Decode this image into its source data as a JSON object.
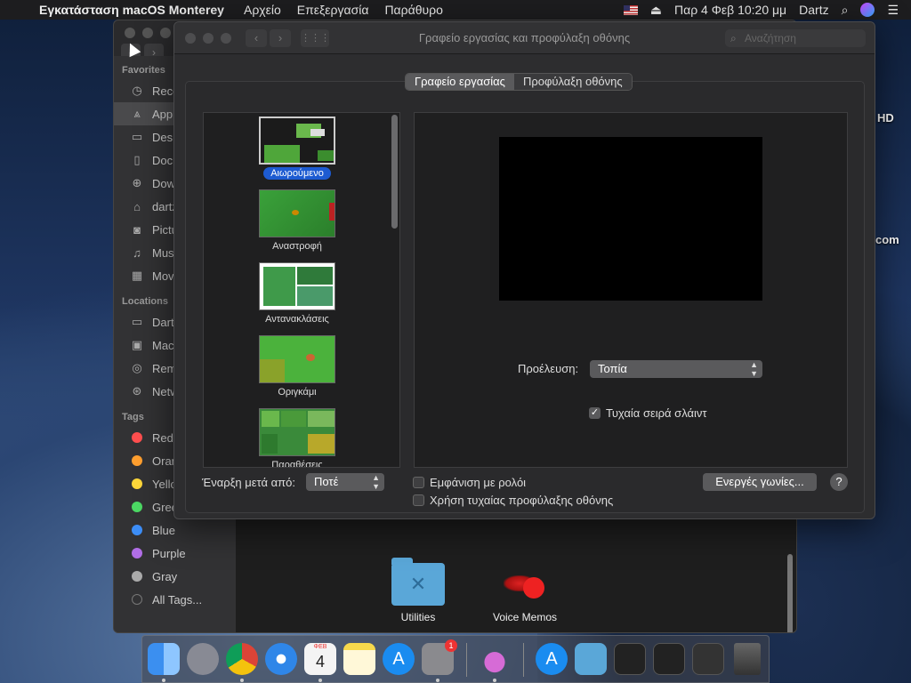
{
  "menubar": {
    "app_name": "Εγκατάσταση macOS Monterey",
    "menus": [
      "Αρχείο",
      "Επεξεργασία",
      "Παράθυρο"
    ],
    "datetime": "Παρ 4 Φεβ  10:20 μμ",
    "user": "Dartz",
    "apple_icon": "apple-icon",
    "search_icon": "magnifier-icon"
  },
  "desktop": {
    "labels": [
      "HD",
      "com"
    ]
  },
  "finder": {
    "favorites_title": "Favorites",
    "favorites": [
      {
        "label": "Recents",
        "icon": "clock-icon"
      },
      {
        "label": "Applications",
        "icon": "apps-icon"
      },
      {
        "label": "Desktop",
        "icon": "desktop-icon"
      },
      {
        "label": "Documents",
        "icon": "document-icon"
      },
      {
        "label": "Downloads",
        "icon": "download-icon"
      },
      {
        "label": "dartz",
        "icon": "home-icon"
      },
      {
        "label": "Pictures",
        "icon": "camera-icon"
      },
      {
        "label": "Music",
        "icon": "music-icon"
      },
      {
        "label": "Movies",
        "icon": "film-icon"
      }
    ],
    "locations_title": "Locations",
    "locations": [
      {
        "label": "Dartz",
        "icon": "computer-icon"
      },
      {
        "label": "Macintosh HD",
        "icon": "disk-icon"
      },
      {
        "label": "Remote Disc",
        "icon": "disc-icon"
      },
      {
        "label": "Network",
        "icon": "network-icon"
      }
    ],
    "tags_title": "Tags",
    "tags": [
      {
        "label": "Red",
        "color": "#ff4f4f"
      },
      {
        "label": "Orange",
        "color": "#ff9f2f"
      },
      {
        "label": "Yellow",
        "color": "#ffd83a"
      },
      {
        "label": "Green",
        "color": "#4cd964"
      },
      {
        "label": "Blue",
        "color": "#3d8ef7"
      },
      {
        "label": "Purple",
        "color": "#b16ee6"
      },
      {
        "label": "Gray",
        "color": "#aaaaaa"
      }
    ],
    "all_tags": "All Tags...",
    "files": [
      {
        "label": "Utilities"
      },
      {
        "label": "Voice Memos"
      }
    ]
  },
  "prefs": {
    "window_title": "Γραφείο εργασίας και προφύλαξη οθόνης",
    "search_placeholder": "Αναζήτηση",
    "tabs": [
      {
        "label": "Γραφείο εργασίας",
        "active": true
      },
      {
        "label": "Προφύλαξη οθόνης",
        "active": false
      }
    ],
    "screensavers": [
      {
        "label": "Αιωρούμενο",
        "selected": true
      },
      {
        "label": "Αναστροφή",
        "selected": false
      },
      {
        "label": "Αντανακλάσεις",
        "selected": false
      },
      {
        "label": "Οριγκάμι",
        "selected": false
      },
      {
        "label": "Παραθέσεις",
        "selected": false
      }
    ],
    "source_label": "Προέλευση:",
    "source_value": "Τοπία",
    "shuffle_label": "Τυχαία σειρά σλάιντ",
    "shuffle_checked": true,
    "start_label": "Έναρξη μετά από:",
    "start_value": "Ποτέ",
    "show_clock_label": "Εμφάνιση με ρολόι",
    "random_label": "Χρήση τυχαίας προφύλαξης οθόνης",
    "hot_corners_label": "Ενεργές γωνίες...",
    "help_label": "?"
  },
  "dock": {
    "apps": [
      {
        "name": "finder",
        "color": "#3b8ff0"
      },
      {
        "name": "launchpad",
        "color": "#888a94"
      },
      {
        "name": "chrome",
        "color": "#e8e8e8"
      },
      {
        "name": "safari",
        "color": "#2f86e8"
      },
      {
        "name": "calendar",
        "color": "#f4f4f4"
      },
      {
        "name": "notes",
        "color": "#f7d94c"
      },
      {
        "name": "app-store",
        "color": "#1a8cf0"
      },
      {
        "name": "system-preferences",
        "color": "#8a8a8e"
      },
      {
        "name": "macos-installer",
        "color": "#7a5fb8"
      },
      {
        "name": "app-store-2",
        "color": "#1a8cf0"
      },
      {
        "name": "folder",
        "color": "#5aa7d8"
      },
      {
        "name": "window-thumb-1",
        "color": "#222"
      },
      {
        "name": "window-thumb-2",
        "color": "#222"
      },
      {
        "name": "window-thumb-3",
        "color": "#333"
      },
      {
        "name": "trash",
        "color": "#555"
      }
    ],
    "calendar_day": "4",
    "calendar_month": "ΦΕΒ",
    "prefs_badge": "1"
  }
}
